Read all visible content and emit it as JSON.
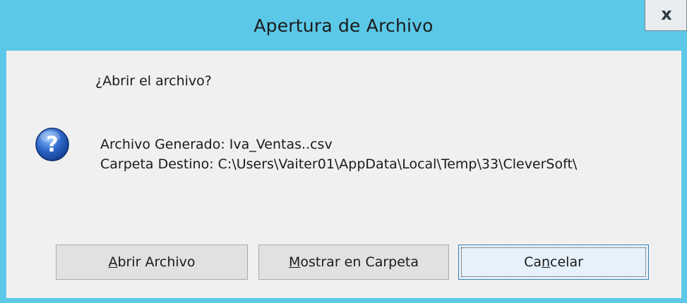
{
  "window": {
    "title": "Apertura de Archivo",
    "close_glyph": "x"
  },
  "content": {
    "question": "¿Abrir el archivo?",
    "icon": "question-icon",
    "generated_file_line": "Archivo Generado: Iva_Ventas..csv",
    "destination_folder_line": "Carpeta Destino: C:\\Users\\Vaiter01\\AppData\\Local\\Temp\\33\\CleverSoft\\"
  },
  "buttons": {
    "open_file": {
      "accel": "A",
      "rest": "brir Archivo"
    },
    "show_in_folder": {
      "accel": "M",
      "rest": "ostrar en Carpeta"
    },
    "cancel": {
      "before": "Ca",
      "accel": "n",
      "rest": "celar"
    }
  },
  "colors": {
    "titlebar": "#5bc8e8",
    "client": "#f0f0f0",
    "button": "#e1e1e1",
    "focused_button_border": "#3c7fb1",
    "icon": "#2a64c5"
  }
}
